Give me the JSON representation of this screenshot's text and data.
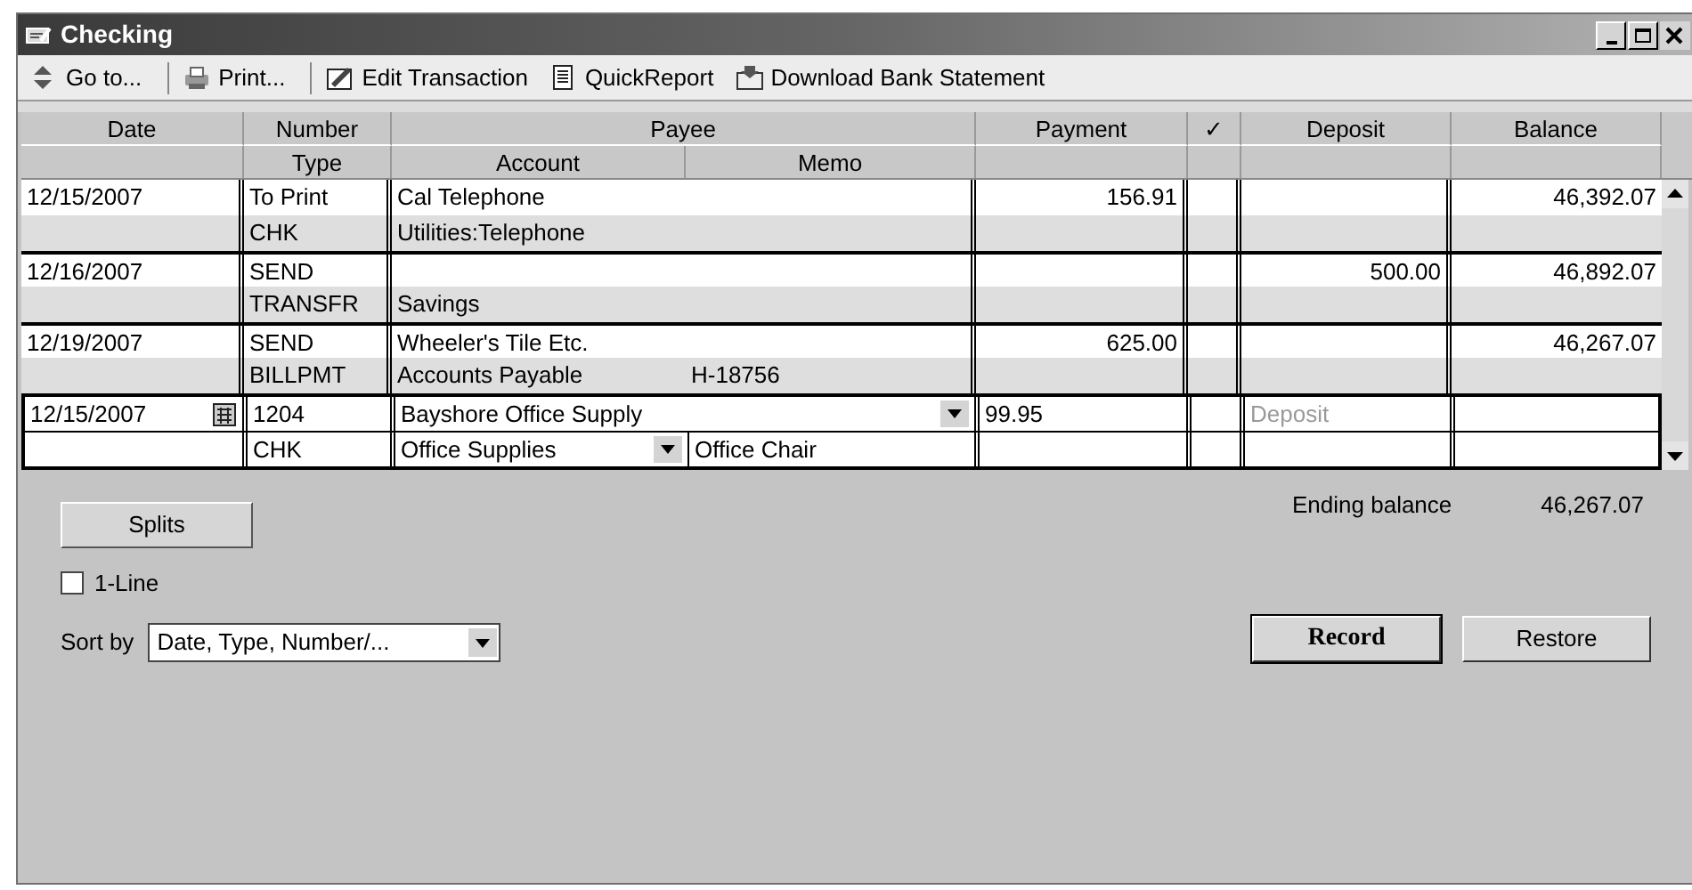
{
  "window": {
    "title": "Checking"
  },
  "toolbar": [
    {
      "label": "Go to..."
    },
    {
      "label": "Print..."
    },
    {
      "label": "Edit Transaction"
    },
    {
      "label": "QuickReport"
    },
    {
      "label": "Download Bank Statement"
    }
  ],
  "header_row_1": [
    "Date",
    "Number",
    "Payee",
    "Payment",
    "✓",
    "Deposit",
    "Balance"
  ],
  "header_row_2": [
    "Type",
    "Account",
    "Memo"
  ],
  "transactions": [
    {
      "date": "12/15/2007",
      "number": "To Print",
      "payee": "Cal Telephone",
      "payment": "156.91",
      "balance": "46,392.07",
      "type": "CHK",
      "account": "Utilities:Telephone"
    },
    {
      "date": "12/16/2007",
      "number": "SEND",
      "deposit": "500.00",
      "balance": "46,892.07",
      "type": "TRANSFR",
      "account": "Savings"
    },
    {
      "date": "12/19/2007",
      "number": "SEND",
      "payee": "Wheeler's Tile Etc.",
      "payment": "625.00",
      "balance": "46,267.07",
      "type": "BILLPMT",
      "account": "Accounts Payable",
      "memo": "H-18756"
    }
  ],
  "edit_row": {
    "date": "12/15/2007",
    "number": "1204",
    "payee": "Bayshore Office Supply",
    "payment": "99.95",
    "deposit_placeholder": "Deposit",
    "type": "CHK",
    "account": "Office Supplies",
    "memo": "Office Chair"
  },
  "splits_button": "Splits",
  "one_line": {
    "label": "1-Line",
    "checked": false
  },
  "sort_by": {
    "label": "Sort by",
    "value": "Date, Type, Number/..."
  },
  "ending_balance": {
    "label": "Ending balance",
    "value": "46,267.07"
  },
  "buttons": [
    {
      "label": "Record",
      "default": true
    },
    {
      "label": "Restore",
      "default": false
    }
  ]
}
